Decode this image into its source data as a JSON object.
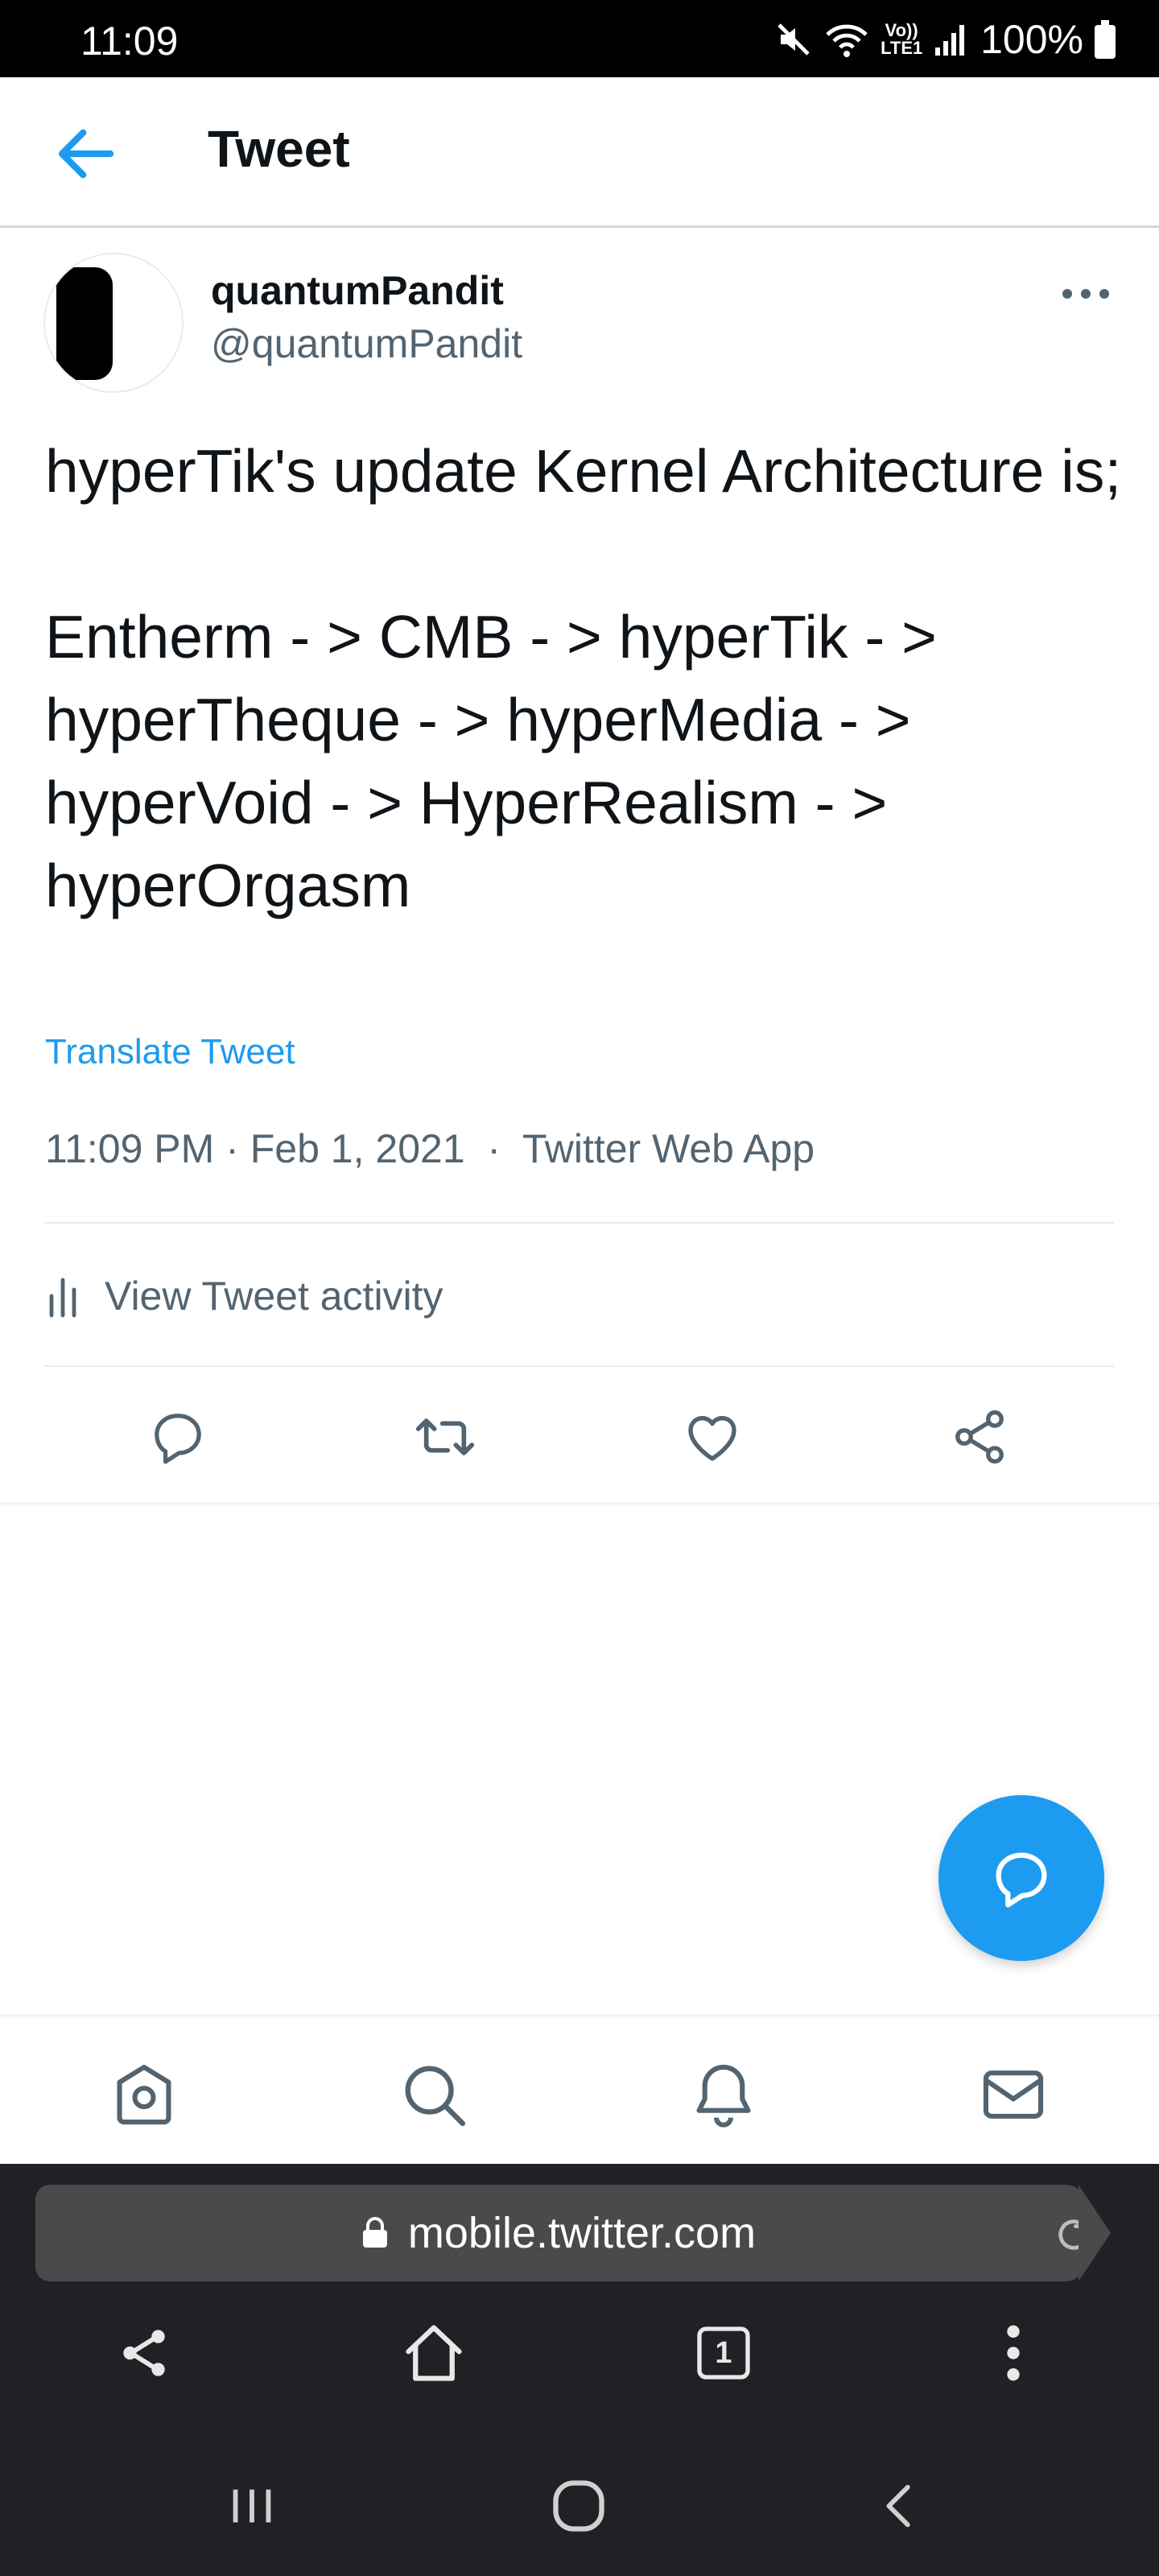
{
  "status_bar": {
    "time": "11:09",
    "network_label": "Vo)) LTE1",
    "battery": "100%"
  },
  "header": {
    "title": "Tweet",
    "back_icon": "arrow-left-icon"
  },
  "tweet": {
    "display_name": "quantumPandit",
    "handle": "@quantumPandit",
    "text": "hyperTik's update Kernel Architecture is;\n\nEntherm - > CMB - > hyperTik - > hyperTheque - > hyperMedia - > hyperVoid - > HyperRealism - > hyperOrgasm",
    "translate_label": "Translate Tweet",
    "time": "11:09 PM",
    "date": "Feb 1, 2021",
    "source": "Twitter Web App",
    "activity_label": "View Tweet activity",
    "actions": [
      "reply-icon",
      "retweet-icon",
      "like-icon",
      "share-icon"
    ]
  },
  "fab": {
    "icon": "compose-reply-icon"
  },
  "tab_bar": {
    "tabs": [
      "home-icon",
      "search-icon",
      "notifications-icon",
      "messages-icon"
    ]
  },
  "browser": {
    "url": "mobile.twitter.com",
    "nav": [
      "share-icon",
      "home-icon",
      "tabs-icon",
      "more-icon"
    ],
    "tab_count": "1"
  },
  "colors": {
    "accent": "#1d9bf0",
    "text_primary": "#0f1419",
    "text_secondary": "#536471",
    "browser_bg": "#202124"
  }
}
